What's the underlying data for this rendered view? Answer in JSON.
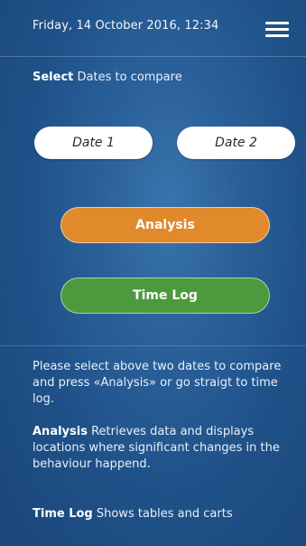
{
  "header": {
    "datetime": "Friday, 14 October 2016, 12:34",
    "menu_icon": "hamburger-menu-icon"
  },
  "select": {
    "bold": "Select",
    "rest": " Dates to compare"
  },
  "dates": {
    "date1_label": "Date 1",
    "date2_label": "Date 2"
  },
  "actions": {
    "analysis_label": "Analysis",
    "timelog_label": "Time Log"
  },
  "info": {
    "intro": "Please select above two dates to compare and press «Analysis» or go straigt to time log.",
    "analysis_term": "Analysis",
    "analysis_desc": " Retrieves data and displays locations where significant changes in the behaviour happend.",
    "timelog_term": "Time Log",
    "timelog_desc": " Shows tables and carts"
  },
  "colors": {
    "background": "#2a609a",
    "analysis_button": "#e08a2c",
    "timelog_button": "#4c9a3e",
    "date_button": "#ffffff"
  }
}
